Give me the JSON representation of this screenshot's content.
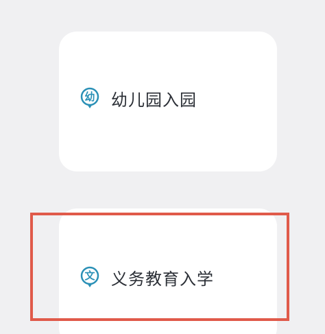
{
  "cards": [
    {
      "badge_text": "幼",
      "label": "幼儿园入园",
      "icon": "kindergarten-badge-icon"
    },
    {
      "badge_text": "文",
      "label": "义务教育入学",
      "icon": "compulsory-education-badge-icon"
    }
  ],
  "colors": {
    "background": "#f0f0f2",
    "card": "#ffffff",
    "accent": "#2a90b6",
    "highlight": "#e05a4a",
    "text": "#2b2f36"
  }
}
